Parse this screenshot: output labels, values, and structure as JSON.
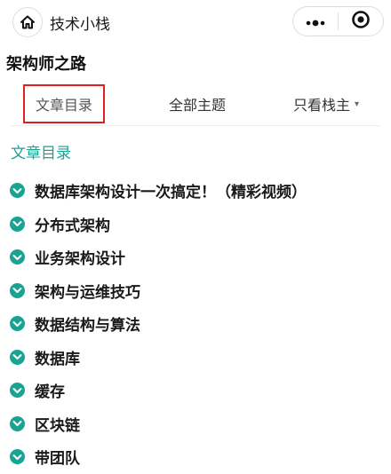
{
  "navbar": {
    "title": "技术小栈",
    "home_icon": "home-icon",
    "more_icon": "more-dots-icon",
    "close_icon": "target-circle-icon"
  },
  "page": {
    "title": "架构师之路"
  },
  "tabs": [
    {
      "label": "文章目录",
      "active": true
    },
    {
      "label": "全部主题"
    },
    {
      "label": "只看栈主",
      "caret": "▾"
    }
  ],
  "section": {
    "title": "文章目录"
  },
  "categories": [
    {
      "label": "数据库架构设计一次搞定！（精彩视频）"
    },
    {
      "label": "分布式架构"
    },
    {
      "label": "业务架构设计"
    },
    {
      "label": "架构与运维技巧"
    },
    {
      "label": "数据结构与算法"
    },
    {
      "label": "数据库"
    },
    {
      "label": "缓存"
    },
    {
      "label": "区块链"
    },
    {
      "label": "带团队"
    }
  ],
  "colors": {
    "accent": "#1aa393",
    "active_tab_border": "#e02020",
    "text": "#1a1a1a"
  }
}
